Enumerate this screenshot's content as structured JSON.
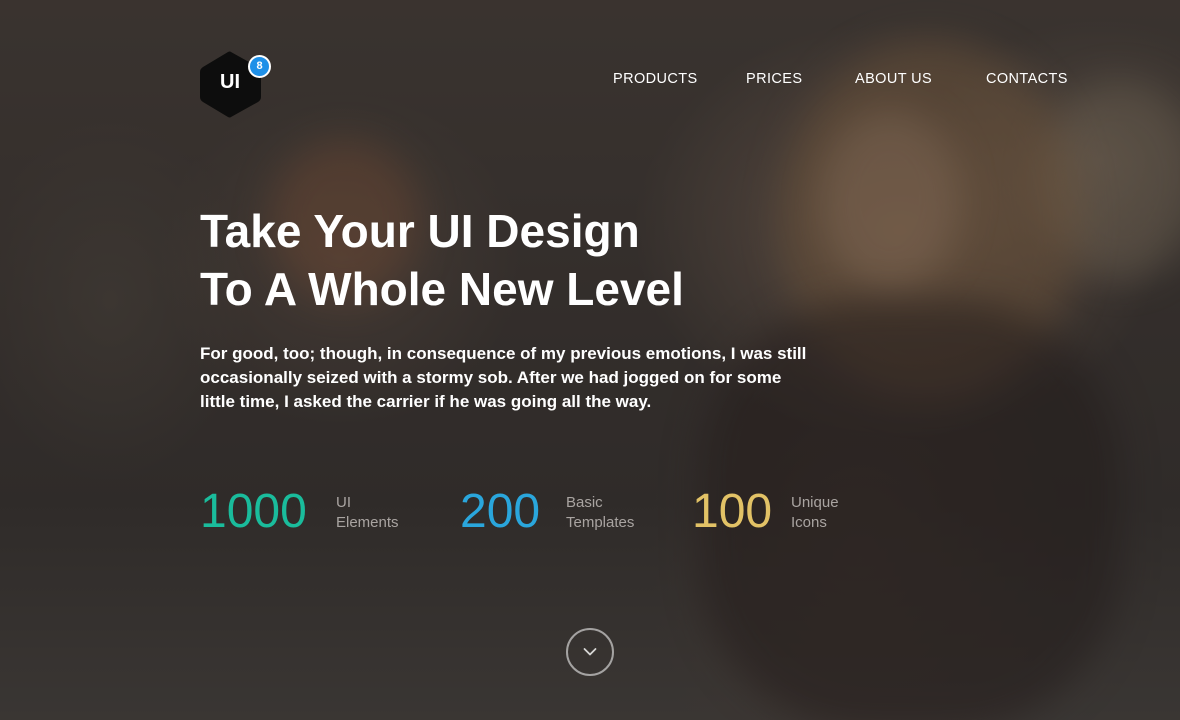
{
  "logo": {
    "text": "UI",
    "badge": "8"
  },
  "nav": {
    "items": [
      {
        "label": "PRODUCTS"
      },
      {
        "label": "PRICES"
      },
      {
        "label": "ABOUT US"
      },
      {
        "label": "CONTACTS"
      }
    ]
  },
  "hero": {
    "headline_line1": "Take Your UI Design",
    "headline_line2": "To A Whole New Level",
    "lead": "For good, too; though, in consequence of my previous emotions, I was still occasionally seized with a stormy sob. After we had jogged on for some little time, I asked the carrier if he was going all the way."
  },
  "stats": [
    {
      "number": "1000",
      "label_line1": "UI",
      "label_line2": "Elements",
      "color": "#1abc9c"
    },
    {
      "number": "200",
      "label_line1": "Basic",
      "label_line2": "Templates",
      "color": "#2aa6dc"
    },
    {
      "number": "100",
      "label_line1": "Unique",
      "label_line2": "Icons",
      "color": "#e2c266"
    }
  ],
  "icons": {
    "scroll": "chevron-down-icon",
    "logo": "hexagon-logo-icon"
  },
  "colors": {
    "badge": "#1e90e8",
    "logo_bg": "#0d0d0d"
  }
}
